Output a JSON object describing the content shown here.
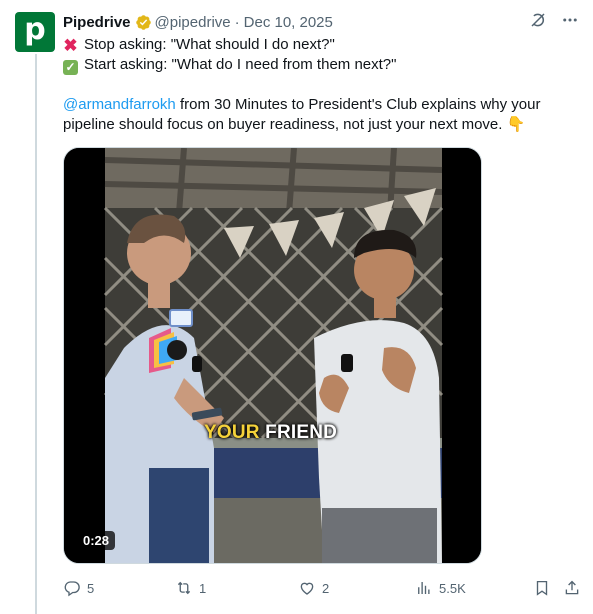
{
  "tweet": {
    "author": "Pipedrive",
    "handle": "@pipedrive",
    "separator": "·",
    "date": "Dec 10, 2025",
    "avatar_letter": "p",
    "line1": "Stop asking: \"What should I do next?\"",
    "line2": "Start asking: \"What do I need from them next?\"",
    "mention": "@armandfarrokh",
    "line3": " from 30 Minutes to President's Club explains why your pipeline should focus on buyer readiness, not just your next move.",
    "emoji_end": "👇"
  },
  "media": {
    "duration": "0:28",
    "caption_yellow": "YOUR",
    "caption_white": " FRIEND"
  },
  "actions": {
    "replies": "5",
    "reposts": "1",
    "likes": "2",
    "views": "5.5K"
  },
  "colors": {
    "brand": "#017737",
    "verified": "#e2b719",
    "link": "#1d9bf0",
    "muted": "#536471"
  },
  "icons": [
    "grok-icon",
    "more-icon",
    "verified-badge-icon",
    "reply-icon",
    "repost-icon",
    "like-icon",
    "views-icon",
    "bookmark-icon",
    "share-icon"
  ]
}
